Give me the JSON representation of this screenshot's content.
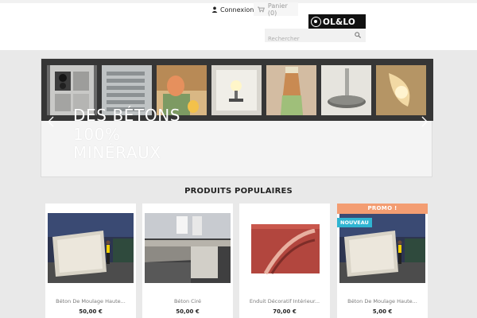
{
  "header": {
    "connexion_label": "Connexion",
    "cart_label": "Panier (0)",
    "logo_text": "OL&LO",
    "search_placeholder": "Rechercher"
  },
  "carousel": {
    "caption_lines": [
      "DES BÉTONS",
      "100%",
      "MINÉRAUX"
    ],
    "tiles": [
      "bottles-rack",
      "grey-slats",
      "eggs-stand",
      "lamp",
      "vase",
      "shelf",
      "curved-lamp"
    ]
  },
  "section": {
    "title": "PRODUITS POPULAIRES"
  },
  "products": [
    {
      "name": "Béton De Moulage Haute...",
      "price": "50,00 €",
      "badges": []
    },
    {
      "name": "Béton Ciré",
      "price": "50,00 €",
      "badges": []
    },
    {
      "name": "Enduit Décoratif Intérieur...",
      "price": "70,00 €",
      "badges": []
    },
    {
      "name": "Béton De Moulage Haute...",
      "price": "5,00 €",
      "badges": [
        "PROMO !",
        "NOUVEAU"
      ]
    }
  ],
  "colors": {
    "promo": "#f39d72",
    "new": "#2fb5d2",
    "carousel_band": "#363636",
    "logo_bg": "#111111"
  }
}
